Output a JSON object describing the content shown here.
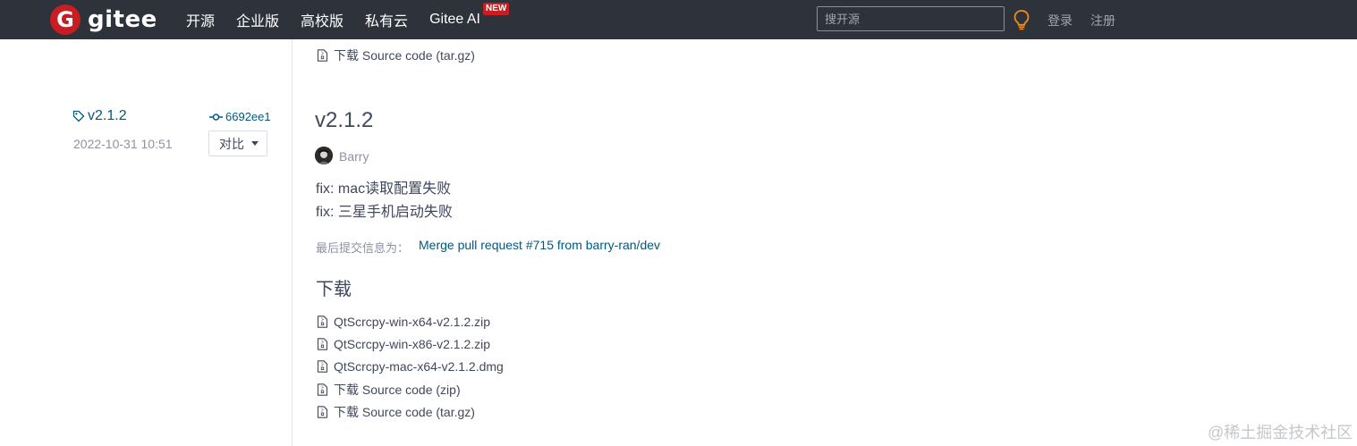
{
  "navbar": {
    "logo_text": "gitee",
    "logo_mark": "G",
    "items": [
      "开源",
      "企业版",
      "高校版",
      "私有云",
      "Gitee AI"
    ],
    "new_badge": "NEW",
    "search_placeholder": "搜开源",
    "login": "登录",
    "register": "注册",
    "bulb_icon": "lightbulb-icon",
    "accent_color": "#c71d23"
  },
  "previous_release": {
    "source_targz": "下载 Source code (tar.gz)"
  },
  "release": {
    "tag": "v2.1.2",
    "commit": "6692ee1",
    "date": "2022-10-31 10:51",
    "compare_label": "对比",
    "title": "v2.1.2",
    "author": "Barry",
    "notes": [
      "fix: mac读取配置失败",
      "fix: 三星手机启动失败"
    ],
    "last_commit_label": "最后提交信息为：",
    "last_commit_message": "Merge pull request #715 from barry-ran/dev",
    "downloads_heading": "下载",
    "downloads": [
      "QtScrcpy-win-x64-v2.1.2.zip",
      "QtScrcpy-win-x86-v2.1.2.zip",
      "QtScrcpy-mac-x64-v2.1.2.dmg",
      "下载 Source code (zip)",
      "下载 Source code (tar.gz)"
    ]
  },
  "watermark": "@稀土掘金技术社区"
}
